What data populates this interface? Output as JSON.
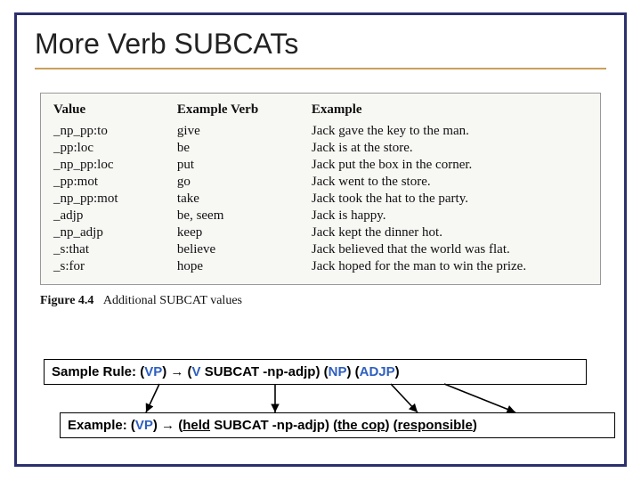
{
  "title": "More Verb SUBCATs",
  "table": {
    "headers": {
      "value": "Value",
      "verb": "Example Verb",
      "example": "Example"
    },
    "rows": [
      {
        "value": "_np_pp:to",
        "verb": "give",
        "example": "Jack gave the key to the man."
      },
      {
        "value": "_pp:loc",
        "verb": "be",
        "example": "Jack is at the store."
      },
      {
        "value": "_np_pp:loc",
        "verb": "put",
        "example": "Jack put the box in the corner."
      },
      {
        "value": "_pp:mot",
        "verb": "go",
        "example": "Jack went to the store."
      },
      {
        "value": "_np_pp:mot",
        "verb": "take",
        "example": "Jack took the hat to the party."
      },
      {
        "value": "_adjp",
        "verb": "be, seem",
        "example": "Jack is happy."
      },
      {
        "value": "_np_adjp",
        "verb": "keep",
        "example": "Jack kept the dinner hot."
      },
      {
        "value": "_s:that",
        "verb": "believe",
        "example": "Jack believed that the world was flat."
      },
      {
        "value": "_s:for",
        "verb": "hope",
        "example": "Jack hoped for the man to win the prize."
      }
    ]
  },
  "caption": {
    "label": "Figure 4.4",
    "text": "Additional SUBCAT values"
  },
  "rule": {
    "prefix": "Sample Rule:  (",
    "lhs_nt": "VP",
    "lhs_close": ") ",
    "arrow": "→",
    "rhs_open": " (",
    "p1_nt": "V",
    "p1_attr": " SUBCAT -np-adjp",
    "p1_close": ") (",
    "p2_nt": "NP",
    "p2_close": ") (",
    "p3_nt": "ADJP",
    "p3_close": ")"
  },
  "example": {
    "prefix": "Example:  (",
    "lhs_nt": "VP",
    "lhs_close": ") ",
    "arrow": "→",
    "rhs_open": " (",
    "p1_word": "held",
    "p1_attr": " SUBCAT -np-adjp",
    "p1_close": ") (",
    "p2_word": "the cop",
    "p2_close": ") (",
    "p3_word": "responsible",
    "p3_close": ")"
  }
}
